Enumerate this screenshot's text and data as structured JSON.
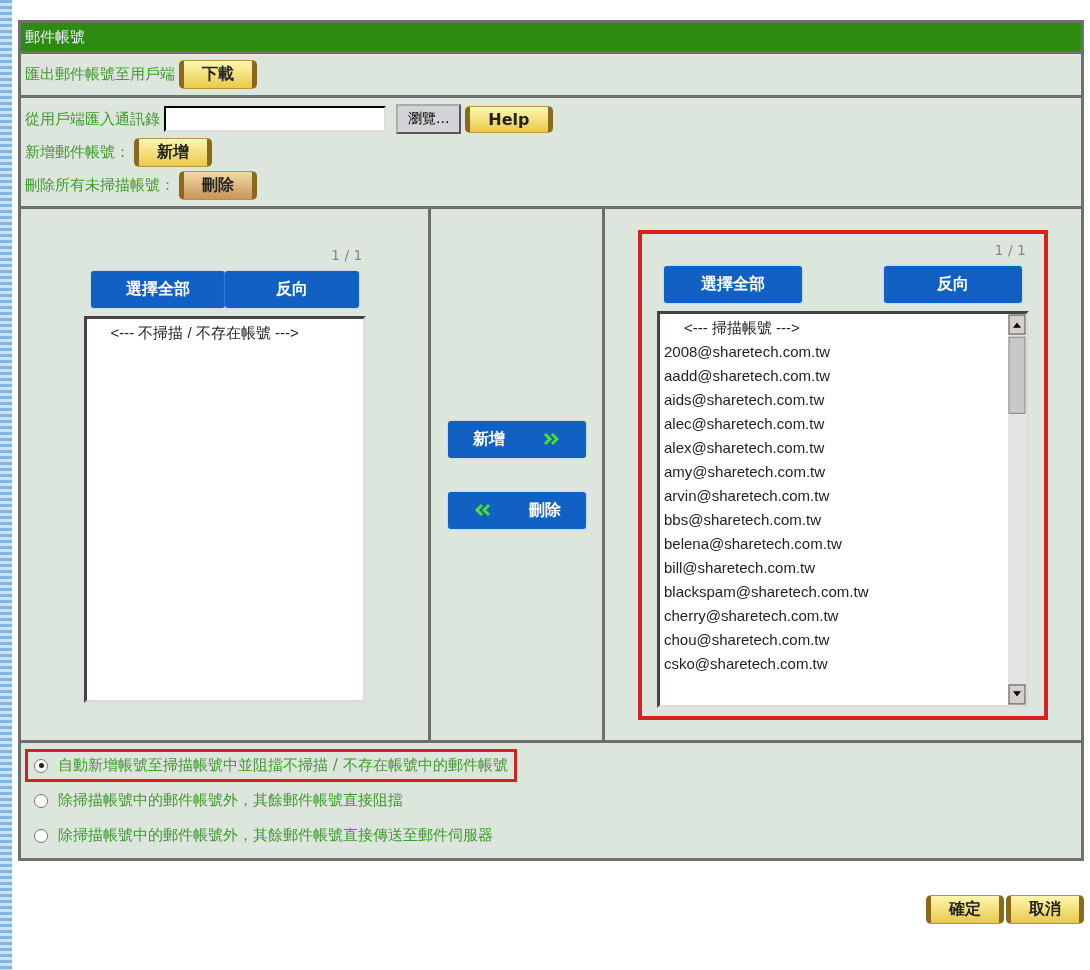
{
  "title": "郵件帳號",
  "export_row": {
    "label": "匯出郵件帳號至用戶端",
    "button": "下載"
  },
  "import_row": {
    "label": "從用戶端匯入通訊錄",
    "browse": "瀏覽...",
    "help": "Help"
  },
  "add_row": {
    "label": "新增郵件帳號：",
    "button": "新增"
  },
  "delete_row": {
    "label": "刪除所有未掃描帳號：",
    "button": "刪除"
  },
  "left_list": {
    "page": "1 / 1",
    "highlighted": false,
    "buttons": [
      "選擇全部",
      "反向"
    ],
    "items": [
      {
        "text": "<--- 不掃描 / 不存在帳號 --->",
        "kind": "header"
      }
    ]
  },
  "transfer_buttons": [
    {
      "label": "新增",
      "kind": "forward"
    },
    {
      "label": "刪除",
      "kind": "back"
    }
  ],
  "right_list": {
    "page": "1 / 1",
    "highlighted": true,
    "buttons": [
      "選擇全部",
      "反向"
    ],
    "items": [
      {
        "text": "<--- 掃描帳號 --->",
        "kind": "header"
      },
      {
        "text": "2008@sharetech.com.tw",
        "kind": "account"
      },
      {
        "text": "aadd@sharetech.com.tw",
        "kind": "account"
      },
      {
        "text": "aids@sharetech.com.tw",
        "kind": "account"
      },
      {
        "text": "alec@sharetech.com.tw",
        "kind": "account"
      },
      {
        "text": "alex@sharetech.com.tw",
        "kind": "account"
      },
      {
        "text": "amy@sharetech.com.tw",
        "kind": "account"
      },
      {
        "text": "arvin@sharetech.com.tw",
        "kind": "account"
      },
      {
        "text": "bbs@sharetech.com.tw",
        "kind": "account"
      },
      {
        "text": "belena@sharetech.com.tw",
        "kind": "account"
      },
      {
        "text": "bill@sharetech.com.tw",
        "kind": "account"
      },
      {
        "text": "blackspam@sharetech.com.tw",
        "kind": "account"
      },
      {
        "text": "cherry@sharetech.com.tw",
        "kind": "account"
      },
      {
        "text": "chou@sharetech.com.tw",
        "kind": "account"
      },
      {
        "text": "csko@sharetech.com.tw",
        "kind": "account"
      }
    ]
  },
  "options": [
    {
      "label": "自動新增帳號至掃描帳號中並阻擋不掃描 / 不存在帳號中的郵件帳號",
      "selected": true,
      "highlighted": true
    },
    {
      "label": "除掃描帳號中的郵件帳號外，其餘郵件帳號直接阻擋",
      "selected": false,
      "highlighted": false
    },
    {
      "label": "除掃描帳號中的郵件帳號外，其餘郵件帳號直接傳送至郵件伺服器",
      "selected": false,
      "highlighted": false
    }
  ],
  "footer_buttons": [
    "確定",
    "取消"
  ]
}
